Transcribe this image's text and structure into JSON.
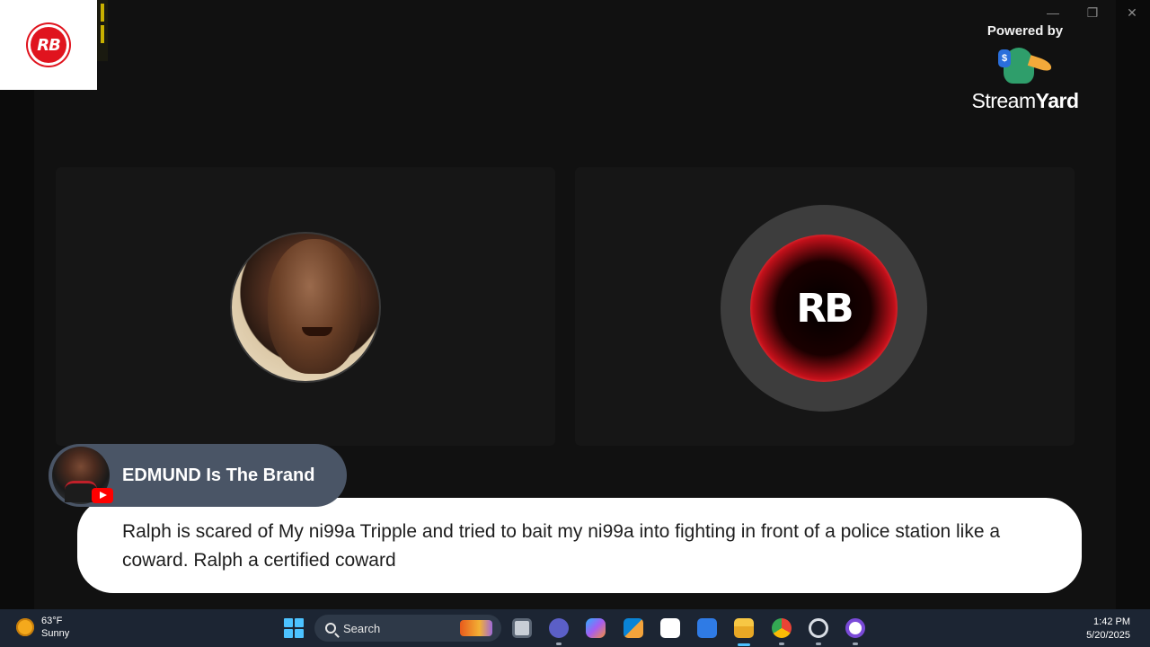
{
  "powered_by": {
    "label": "Powered by",
    "brand_part1": "Stream",
    "brand_part2": "Yard"
  },
  "corner_logo": {
    "text": "RB"
  },
  "window_controls": {
    "minimize": "—",
    "restore": "❐",
    "close": "✕"
  },
  "guest_tile": {
    "logo_text": "RB"
  },
  "lower_third": {
    "name": "EDMUND Is The Brand",
    "comment": "Ralph is scared of My ni99a Tripple and tried to bait my ni99a into fighting in front of a police station like a coward. Ralph a certified coward"
  },
  "taskbar": {
    "weather_temp": "63°F",
    "weather_desc": "Sunny",
    "search_label": "Search",
    "time": "1:42 PM",
    "date": "5/20/2025",
    "apps": [
      "task-view",
      "teams",
      "copilot",
      "microsoft-store",
      "capcut",
      "calendar",
      "file-explorer",
      "chrome",
      "streaming-app",
      "media-player"
    ]
  },
  "colors": {
    "stage_bg": "#111111",
    "comment_bg": "#ffffff",
    "name_pill_bg": "#4a5566",
    "taskbar_bg": "#1c2533",
    "brand_red": "#e0141e"
  }
}
